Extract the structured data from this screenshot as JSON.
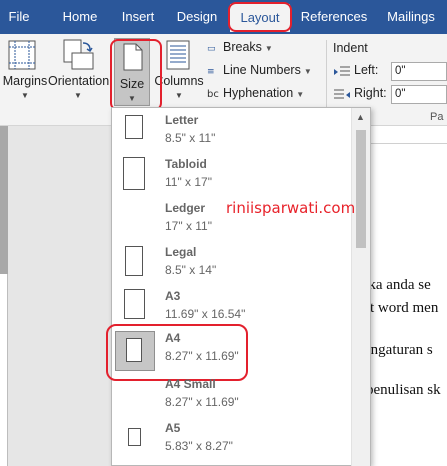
{
  "tabs": [
    {
      "label": "File",
      "active": false
    },
    {
      "label": "Home",
      "active": false
    },
    {
      "label": "Insert",
      "active": false
    },
    {
      "label": "Design",
      "active": false
    },
    {
      "label": "Layout",
      "active": true
    },
    {
      "label": "References",
      "active": false
    },
    {
      "label": "Mailings",
      "active": false
    }
  ],
  "ribbon": {
    "margins_label": "Margins",
    "orientation_label": "Orientation",
    "size_label": "Size",
    "columns_label": "Columns",
    "breaks_label": "Breaks",
    "line_numbers_label": "Line Numbers",
    "hyphenation_label": "Hyphenation",
    "indent": {
      "title": "Indent",
      "left_label": "Left:",
      "left_value": "0\"",
      "right_label": "Right:",
      "right_value": "0\""
    },
    "paragraph_group_label": "Pa"
  },
  "size_menu": {
    "items": [
      {
        "name": "Letter",
        "dims": "8.5\" x 11\"",
        "selected": false
      },
      {
        "name": "Tabloid",
        "dims": "11\" x 17\"",
        "selected": false
      },
      {
        "name": "Ledger",
        "dims": "17\" x 11\"",
        "selected": false
      },
      {
        "name": "Legal",
        "dims": "8.5\" x 14\"",
        "selected": false
      },
      {
        "name": "A3",
        "dims": "11.69\" x 16.54\"",
        "selected": false
      },
      {
        "name": "A4",
        "dims": "8.27\" x 11.69\"",
        "selected": true
      },
      {
        "name": "A4 Small",
        "dims": "8.27\" x 11.69\"",
        "selected": false
      },
      {
        "name": "A5",
        "dims": "5.83\" x 8.27\"",
        "selected": false
      }
    ]
  },
  "watermark": "riniisparwati.com",
  "document": {
    "lines": [
      "jika anda se",
      "ft word men",
      "engaturan s",
      "penulisan sk"
    ]
  },
  "colors": {
    "ribbon_tab_bg": "#2b579a",
    "highlight_red": "#e3202d"
  }
}
